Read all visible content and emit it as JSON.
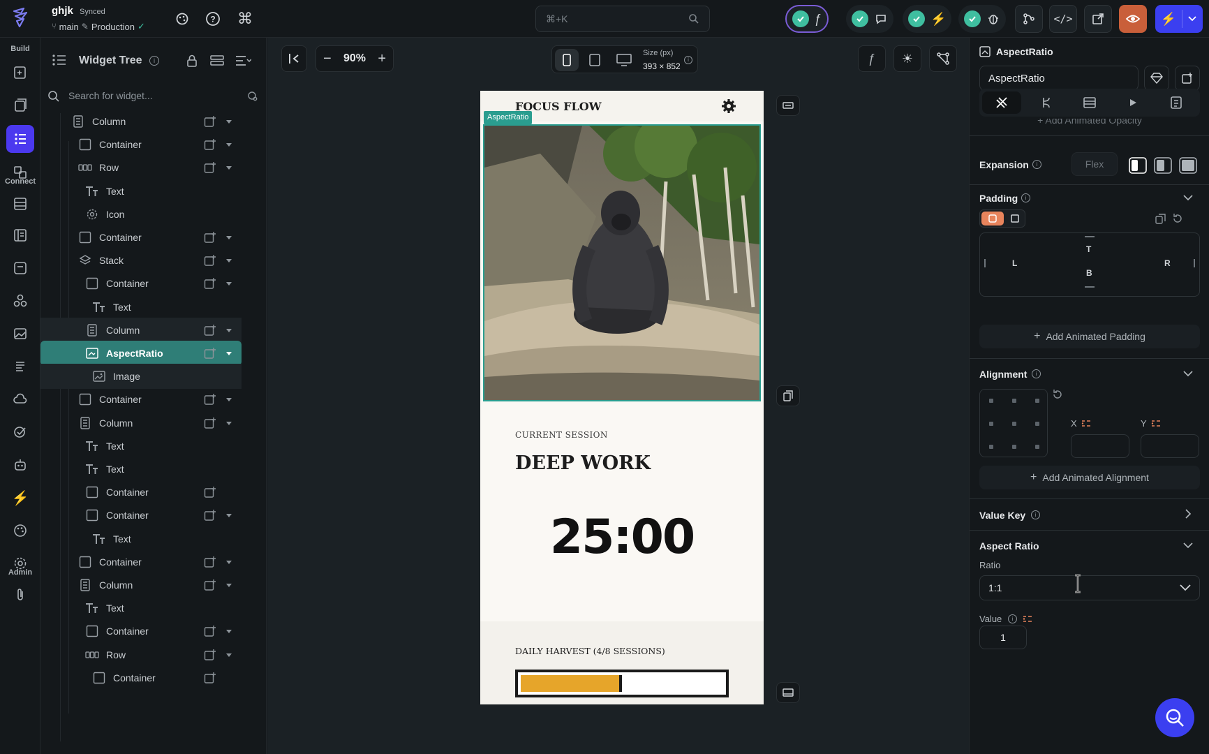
{
  "header": {
    "project_name": "ghjk",
    "sync_status": "Synced",
    "branch": "main",
    "environment": "Production",
    "search_shortcut": "⌘+K"
  },
  "rail": {
    "section_build": "Build",
    "section_connect": "Connect",
    "section_admin": "Admin"
  },
  "widget_tree": {
    "title": "Widget Tree",
    "search_placeholder": "Search for widget...",
    "items": [
      {
        "label": "Column",
        "icon": "column-icon",
        "depth": 0
      },
      {
        "label": "Container",
        "icon": "container-icon",
        "depth": 1
      },
      {
        "label": "Row",
        "icon": "row-icon",
        "depth": 1
      },
      {
        "label": "Text",
        "icon": "text-icon",
        "depth": 2
      },
      {
        "label": "Icon",
        "icon": "gear-icon",
        "depth": 2
      },
      {
        "label": "Container",
        "icon": "container-icon",
        "depth": 1
      },
      {
        "label": "Stack",
        "icon": "stack-icon",
        "depth": 1
      },
      {
        "label": "Container",
        "icon": "container-icon",
        "depth": 2
      },
      {
        "label": "Text",
        "icon": "text-icon",
        "depth": 3
      },
      {
        "label": "Column",
        "icon": "column-icon",
        "depth": 2
      },
      {
        "label": "AspectRatio",
        "icon": "aspect-ratio-icon",
        "depth": 2
      },
      {
        "label": "Image",
        "icon": "image-icon",
        "depth": 3
      },
      {
        "label": "Container",
        "icon": "container-icon",
        "depth": 1
      },
      {
        "label": "Column",
        "icon": "column-icon",
        "depth": 1
      },
      {
        "label": "Text",
        "icon": "text-icon",
        "depth": 2
      },
      {
        "label": "Text",
        "icon": "text-icon",
        "depth": 2
      },
      {
        "label": "Container",
        "icon": "container-icon",
        "depth": 2
      },
      {
        "label": "Container",
        "icon": "container-icon",
        "depth": 2
      },
      {
        "label": "Text",
        "icon": "text-icon",
        "depth": 3
      },
      {
        "label": "Container",
        "icon": "container-icon",
        "depth": 1
      },
      {
        "label": "Column",
        "icon": "column-icon",
        "depth": 1
      },
      {
        "label": "Text",
        "icon": "text-icon",
        "depth": 2
      },
      {
        "label": "Container",
        "icon": "container-icon",
        "depth": 2
      },
      {
        "label": "Row",
        "icon": "row-icon",
        "depth": 2
      },
      {
        "label": "Container",
        "icon": "container-icon",
        "depth": 3
      }
    ]
  },
  "canvas": {
    "zoom": "90%",
    "size_label": "Size (px)",
    "size_value": "393 × 852",
    "selected_tag": "AspectRatio",
    "app_title": "FOCUS FLOW",
    "session_label": "CURRENT SESSION",
    "session_name": "DEEP WORK",
    "timer": "25:00",
    "harvest_label": "DAILY HARVEST (4/8 SESSIONS)",
    "harvest_progress": 0.5,
    "accent": "#e6a52a"
  },
  "properties": {
    "widget_type": "AspectRatio",
    "widget_name": "AspectRatio",
    "animated_opacity": "+ Add Animated Opacity",
    "expansion_label": "Expansion",
    "expansion_flex": "Flex",
    "padding_label": "Padding",
    "pad_T": "T",
    "pad_B": "B",
    "pad_L": "L",
    "pad_R": "R",
    "add_animated_padding": "Add Animated Padding",
    "alignment_label": "Alignment",
    "align_x": "X",
    "align_y": "Y",
    "add_animated_alignment": "Add Animated Alignment",
    "value_key_label": "Value Key",
    "aspect_ratio_label": "Aspect Ratio",
    "ratio_label": "Ratio",
    "ratio_value": "1:1",
    "value_label": "Value",
    "value_value": "1"
  }
}
